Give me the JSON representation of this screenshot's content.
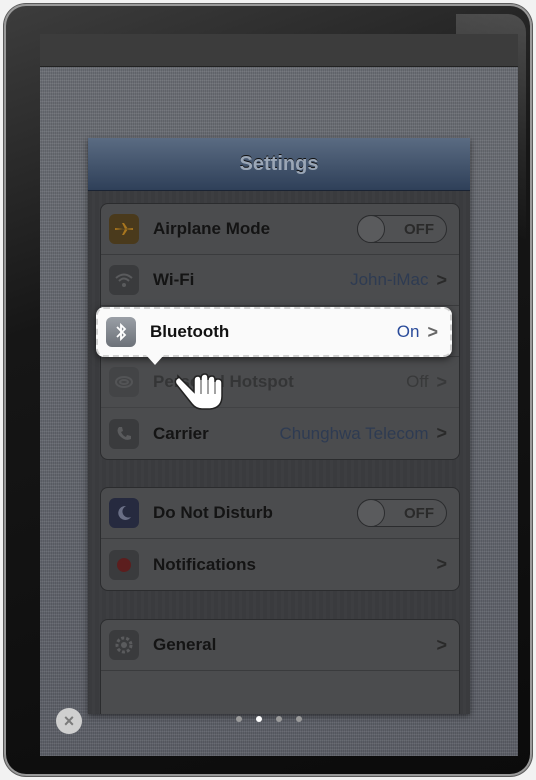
{
  "navbar": {
    "title": "Settings"
  },
  "group1": {
    "airplane": {
      "label": "Airplane Mode",
      "toggle": "OFF"
    },
    "wifi": {
      "label": "Wi-Fi",
      "value": "John-iMac"
    },
    "bluetooth": {
      "label": "Bluetooth",
      "value": "On"
    },
    "hotspot": {
      "label": "Personal Hotspot",
      "value": "Off"
    },
    "carrier": {
      "label": "Carrier",
      "value": "Chunghwa Telecom"
    }
  },
  "group2": {
    "dnd": {
      "label": "Do Not Disturb",
      "toggle": "OFF"
    },
    "notifications": {
      "label": "Notifications"
    }
  },
  "group3": {
    "general": {
      "label": "General"
    }
  },
  "chevron": ">",
  "close_glyph": "×",
  "pager": {
    "pages": 4,
    "active_page": 2
  },
  "colors": {
    "highlight_value": "#2a4b9a",
    "navbar_top": "#5a6b82",
    "navbar_bottom": "#2f4059"
  }
}
